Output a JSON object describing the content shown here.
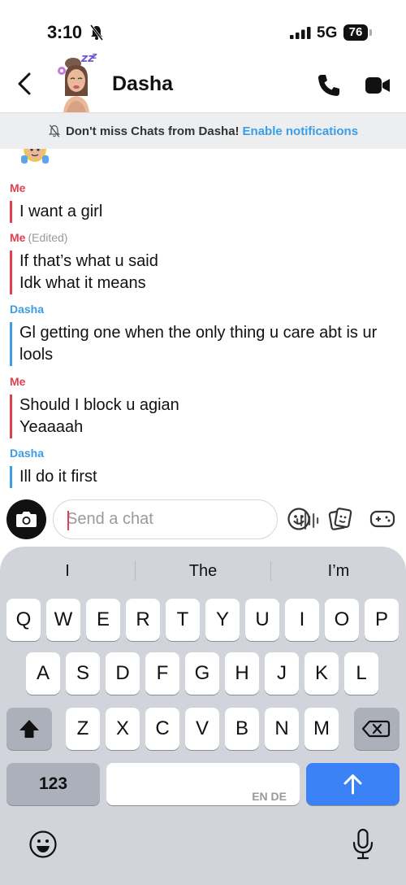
{
  "status_bar": {
    "time": "3:10",
    "network": "5G",
    "battery": "76"
  },
  "header": {
    "contact_name": "Dasha"
  },
  "banner": {
    "text": "Don't miss Chats from Dasha!",
    "link": "Enable notifications"
  },
  "messages": [
    {
      "sender": "Me",
      "edited": "",
      "lines": [
        "I want a girl"
      ]
    },
    {
      "sender": "Me",
      "edited": "(Edited)",
      "lines": [
        "If that’s what u said",
        "Idk what it means"
      ]
    },
    {
      "sender": "Dasha",
      "edited": "",
      "lines": [
        "Gl getting one when the only thing u care abt is ur",
        "lools"
      ]
    },
    {
      "sender": "Me",
      "edited": "",
      "lines": [
        "Should I block u agian",
        "Yeaaaah"
      ]
    },
    {
      "sender": "Dasha",
      "edited": "",
      "lines": [
        "Ill do it first"
      ]
    }
  ],
  "composer": {
    "placeholder": "Send a chat"
  },
  "keyboard": {
    "suggestions": [
      "I",
      "The",
      "I’m"
    ],
    "row1": [
      "Q",
      "W",
      "E",
      "R",
      "T",
      "Y",
      "U",
      "I",
      "O",
      "P"
    ],
    "row2": [
      "A",
      "S",
      "D",
      "F",
      "G",
      "H",
      "J",
      "K",
      "L"
    ],
    "row3": [
      "Z",
      "X",
      "C",
      "V",
      "B",
      "N",
      "M"
    ],
    "numbers_key": "123",
    "language_label": "EN DE"
  },
  "colors": {
    "me": "#e2404e",
    "friend": "#3b9de6",
    "return_key": "#3b82f6"
  }
}
